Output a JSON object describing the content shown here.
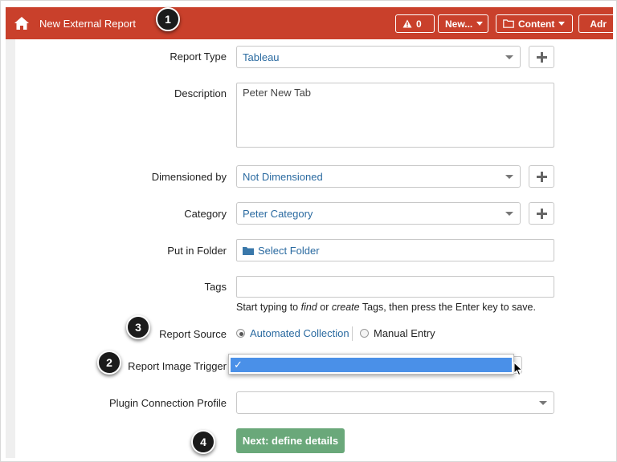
{
  "topbar": {
    "title": "New External Report",
    "alerts_label": "0",
    "new_label": "New...",
    "content_label": "Content",
    "admin_label": "Adr"
  },
  "callouts": [
    "1",
    "2",
    "3",
    "4"
  ],
  "form": {
    "report_type": {
      "label": "Report Type",
      "value": "Tableau"
    },
    "description": {
      "label": "Description",
      "value": "Peter New Tab"
    },
    "dimensioned_by": {
      "label": "Dimensioned by",
      "value": "Not Dimensioned"
    },
    "category": {
      "label": "Category",
      "value": "Peter Category"
    },
    "folder": {
      "label": "Put in Folder",
      "value": "Select Folder"
    },
    "tags": {
      "label": "Tags",
      "value": "",
      "help_prefix": "Start typing to ",
      "help_find": "find",
      "help_or": " or ",
      "help_create": "create",
      "help_suffix": " Tags, then press the Enter key to save."
    },
    "report_source": {
      "label": "Report Source",
      "options": [
        "Automated Collection",
        "Manual Entry"
      ],
      "selected": "Automated Collection"
    },
    "image_trigger": {
      "label": "Report Image Trigger",
      "selected_glyph": "✓"
    },
    "plugin_profile": {
      "label": "Plugin Connection Profile",
      "value": ""
    },
    "next_label": "Next: define details"
  },
  "colors": {
    "topbar": "#c9402b",
    "link": "#2a6aa0",
    "next_button": "#6aa87a",
    "highlight": "#4a90e8"
  },
  "icons": [
    "home-icon",
    "warning-icon",
    "folder-outline-icon",
    "gear-icon",
    "plus-icon",
    "folder-icon",
    "cursor-arrow-icon"
  ]
}
